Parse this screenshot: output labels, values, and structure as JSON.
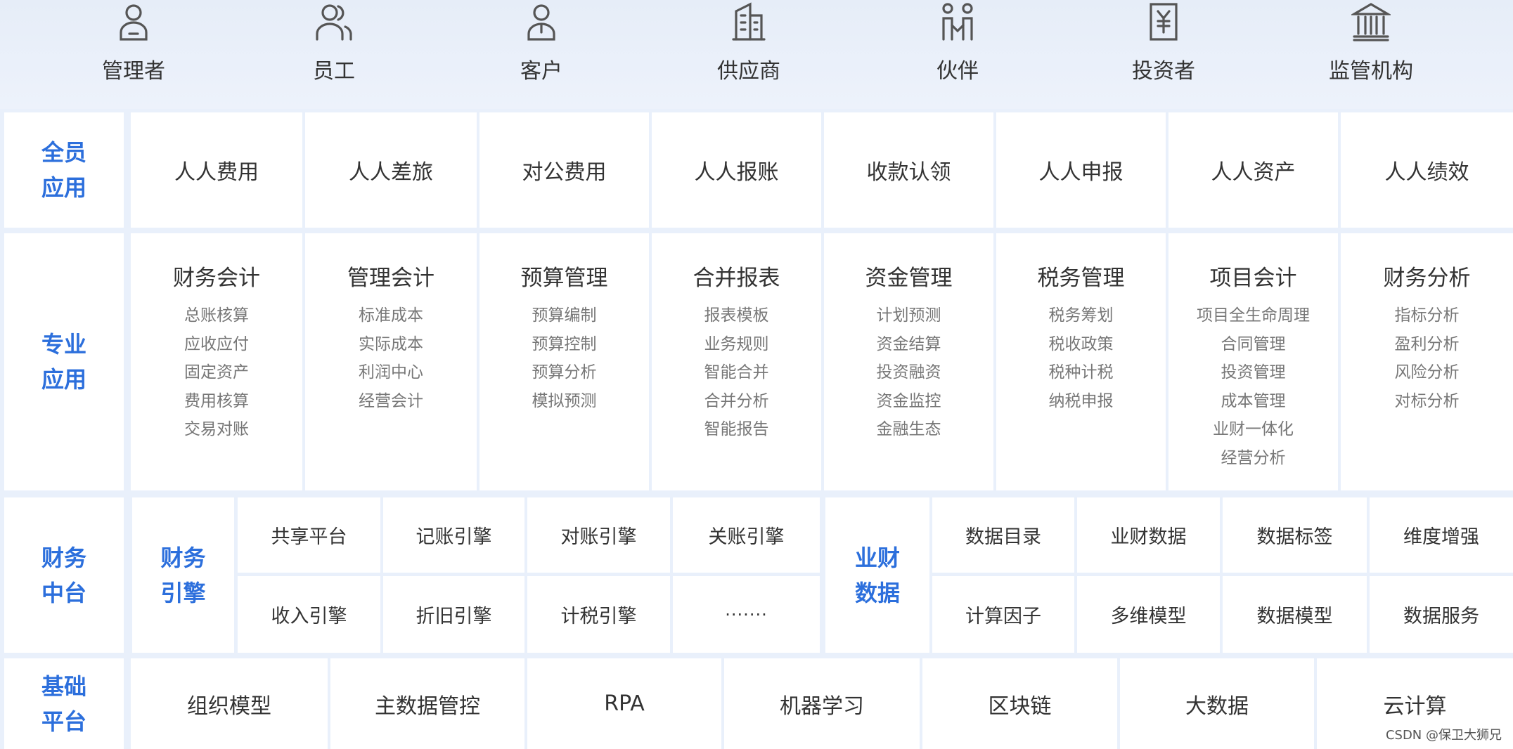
{
  "stakeholders": [
    {
      "label": "管理者",
      "icon": "manager-icon"
    },
    {
      "label": "员工",
      "icon": "employees-icon"
    },
    {
      "label": "客户",
      "icon": "customer-icon"
    },
    {
      "label": "供应商",
      "icon": "supplier-building-icon"
    },
    {
      "label": "伙伴",
      "icon": "partners-icon"
    },
    {
      "label": "投资者",
      "icon": "investor-yen-icon"
    },
    {
      "label": "监管机构",
      "icon": "regulator-bank-icon"
    }
  ],
  "all_staff": {
    "label": "全员应用",
    "items": [
      "人人费用",
      "人人差旅",
      "对公费用",
      "人人报账",
      "收款认领",
      "人人申报",
      "人人资产",
      "人人绩效"
    ]
  },
  "professional": {
    "label": "专业应用",
    "modules": [
      {
        "title": "财务会计",
        "items": [
          "总账核算",
          "应收应付",
          "固定资产",
          "费用核算",
          "交易对账"
        ]
      },
      {
        "title": "管理会计",
        "items": [
          "标准成本",
          "实际成本",
          "利润中心",
          "经营会计"
        ]
      },
      {
        "title": "预算管理",
        "items": [
          "预算编制",
          "预算控制",
          "预算分析",
          "模拟预测"
        ]
      },
      {
        "title": "合并报表",
        "items": [
          "报表模板",
          "业务规则",
          "智能合并",
          "合并分析",
          "智能报告"
        ]
      },
      {
        "title": "资金管理",
        "items": [
          "计划预测",
          "资金结算",
          "投资融资",
          "资金监控",
          "金融生态"
        ]
      },
      {
        "title": "税务管理",
        "items": [
          "税务筹划",
          "税收政策",
          "税种计税",
          "纳税申报"
        ]
      },
      {
        "title": "项目会计",
        "items": [
          "项目全生命周理",
          "合同管理",
          "投资管理",
          "成本管理",
          "业财一体化",
          "经营分析"
        ]
      },
      {
        "title": "财务分析",
        "items": [
          "指标分析",
          "盈利分析",
          "风险分析",
          "对标分析"
        ]
      }
    ]
  },
  "middle": {
    "label": "财务中台",
    "engine": {
      "label": "财务引擎",
      "items": [
        "共享平台",
        "记账引擎",
        "对账引擎",
        "关账引擎",
        "收入引擎",
        "折旧引擎",
        "计税引擎",
        "·······"
      ]
    },
    "data": {
      "label": "业财数据",
      "items": [
        "数据目录",
        "业财数据",
        "数据标签",
        "维度增强",
        "计算因子",
        "多维模型",
        "数据模型",
        "数据服务"
      ]
    }
  },
  "base": {
    "label": "基础平台",
    "items": [
      "组织模型",
      "主数据管控",
      "RPA",
      "机器学习",
      "区块链",
      "大数据",
      "云计算"
    ]
  },
  "watermark": "CSDN @保卫大狮兄",
  "colors": {
    "accent": "#2c6fdc",
    "background": "#e9f0fb",
    "cell": "#ffffff"
  }
}
